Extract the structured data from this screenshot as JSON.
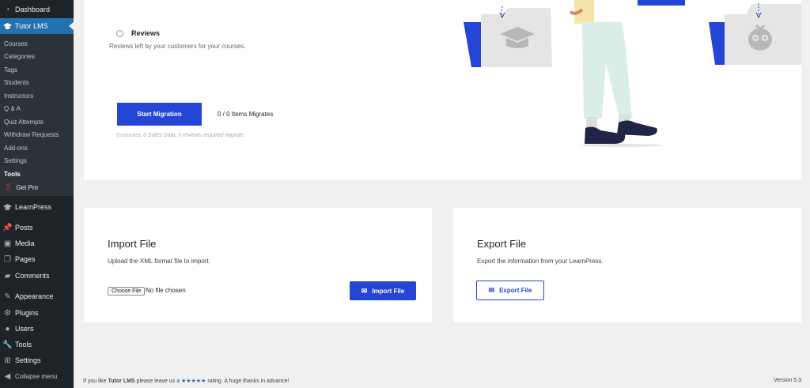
{
  "sidebar": {
    "top_items": [
      {
        "label": "Dashboard",
        "icon": "dashboard-icon"
      },
      {
        "label": "Tutor LMS",
        "icon": "graduation-cap-icon"
      }
    ],
    "submenu": [
      {
        "label": "Courses"
      },
      {
        "label": "Categories"
      },
      {
        "label": "Tags"
      },
      {
        "label": "Students"
      },
      {
        "label": "Instructors"
      },
      {
        "label": "Q & A"
      },
      {
        "label": "Quiz Attempts"
      },
      {
        "label": "Withdraw Requests"
      },
      {
        "label": "Add-ons"
      },
      {
        "label": "Settings"
      },
      {
        "label": "Tools"
      },
      {
        "label": "Get Pro"
      }
    ],
    "items": [
      {
        "label": "LearnPress",
        "icon": "learnpress-icon"
      },
      {
        "label": "Posts",
        "icon": "pin-icon"
      },
      {
        "label": "Media",
        "icon": "media-icon"
      },
      {
        "label": "Pages",
        "icon": "pages-icon"
      },
      {
        "label": "Comments",
        "icon": "comment-icon"
      },
      {
        "label": "Appearance",
        "icon": "brush-icon"
      },
      {
        "label": "Plugins",
        "icon": "plugin-icon"
      },
      {
        "label": "Users",
        "icon": "user-icon"
      },
      {
        "label": "Tools",
        "icon": "wrench-icon"
      },
      {
        "label": "Settings",
        "icon": "settings-icon"
      },
      {
        "label": "Collapse menu",
        "icon": "collapse-icon"
      }
    ]
  },
  "migration": {
    "reviews_label": "Reviews",
    "reviews_desc": "Reviews left by your customers for your courses.",
    "start_button": "Start Migration",
    "items_count": "0 / 0 Items Migrates",
    "note": "0 courses, 0 Sales Data, 0 reviews required migrate"
  },
  "import": {
    "title": "Import File",
    "desc": "Upload the XML format file to import.",
    "choose_button": "Choose File",
    "no_file": "No file chosen",
    "button": "Import File"
  },
  "export": {
    "title": "Export File",
    "desc": "Export the information from your LearnPress.",
    "button": "Export File"
  },
  "footer": {
    "prefix": "If you like ",
    "brand": "Tutor LMS",
    "middle": " please leave us a ",
    "stars": "★★★★★",
    "suffix": " rating. A huge thanks in advance!",
    "version": "Version 5.3"
  },
  "colors": {
    "accent": "#2545d4",
    "sidebar_bg": "#1d2327",
    "active_menu": "#2271b1"
  }
}
